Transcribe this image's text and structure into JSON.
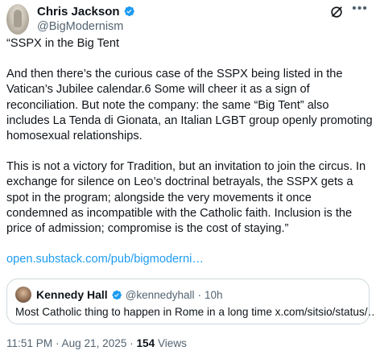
{
  "author": {
    "name": "Chris Jackson",
    "handle": "@BigModernism"
  },
  "icons": {
    "verified": "verified-badge-icon",
    "grok": "grok-icon",
    "more": "more-icon"
  },
  "colors": {
    "link": "#1d9bf0",
    "secondary_text": "#536471",
    "verified": "#1d9bf0"
  },
  "tweet": {
    "title": "“SSPX in the Big Tent",
    "para1": "And then there’s the curious case of the SSPX being listed in the Vatican’s Jubilee calendar.6 Some will cheer it as a sign of reconciliation. But note the company: the same “Big Tent” also includes La Tenda di Gionata, an Italian LGBT group openly promoting homosexual relationships.",
    "para2": "This is not a victory for Tradition, but an invitation to join the circus. In exchange for silence on Leo’s doctrinal betrayals, the SSPX gets a spot in the program; alongside the very movements it once condemned as incompatible with the Catholic faith. Inclusion is the price of admission; compromise is the cost of staying.”",
    "link": "open.substack.com/pub/bigmoderni…"
  },
  "quote": {
    "name": "Kennedy Hall",
    "handle": "@kennedyhall",
    "separator": "·",
    "time": "10h",
    "text": "Most Catholic thing to happen in Rome in a long time x.com/sitsio/status/…"
  },
  "meta": {
    "timestamp": "11:51 PM · Aug 21, 2025 ·",
    "views_count": "154",
    "views_label": "Views"
  }
}
